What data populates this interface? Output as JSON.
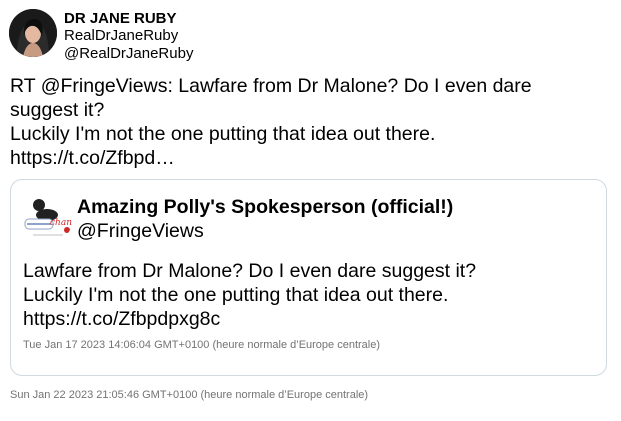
{
  "tweet": {
    "author": {
      "name": "DR JANE RUBY",
      "display_name": "RealDrJaneRuby",
      "handle": "@RealDrJaneRuby"
    },
    "text_lines": [
      "RT @FringeViews: Lawfare from Dr Malone? Do I even dare",
      "suggest it?",
      "Luckily I'm not the one putting that idea out there.",
      "https://t.co/Zfbpd…"
    ],
    "timestamp": "Sun Jan 22 2023 21:05:46 GMT+0100 (heure normale d’Europe centrale)"
  },
  "quoted_tweet": {
    "author": {
      "name": "Amazing Polly's Spokesperson (official!)",
      "handle": "@FringeViews",
      "avatar_text": "changed"
    },
    "text_lines": [
      "Lawfare from Dr Malone? Do I even dare suggest it?",
      "Luckily I'm not the one putting that idea out there.",
      "https://t.co/Zfbpdpxg8c"
    ],
    "timestamp": "Tue Jan 17 2023 14:06:04 GMT+0100 (heure normale d’Europe centrale)"
  }
}
